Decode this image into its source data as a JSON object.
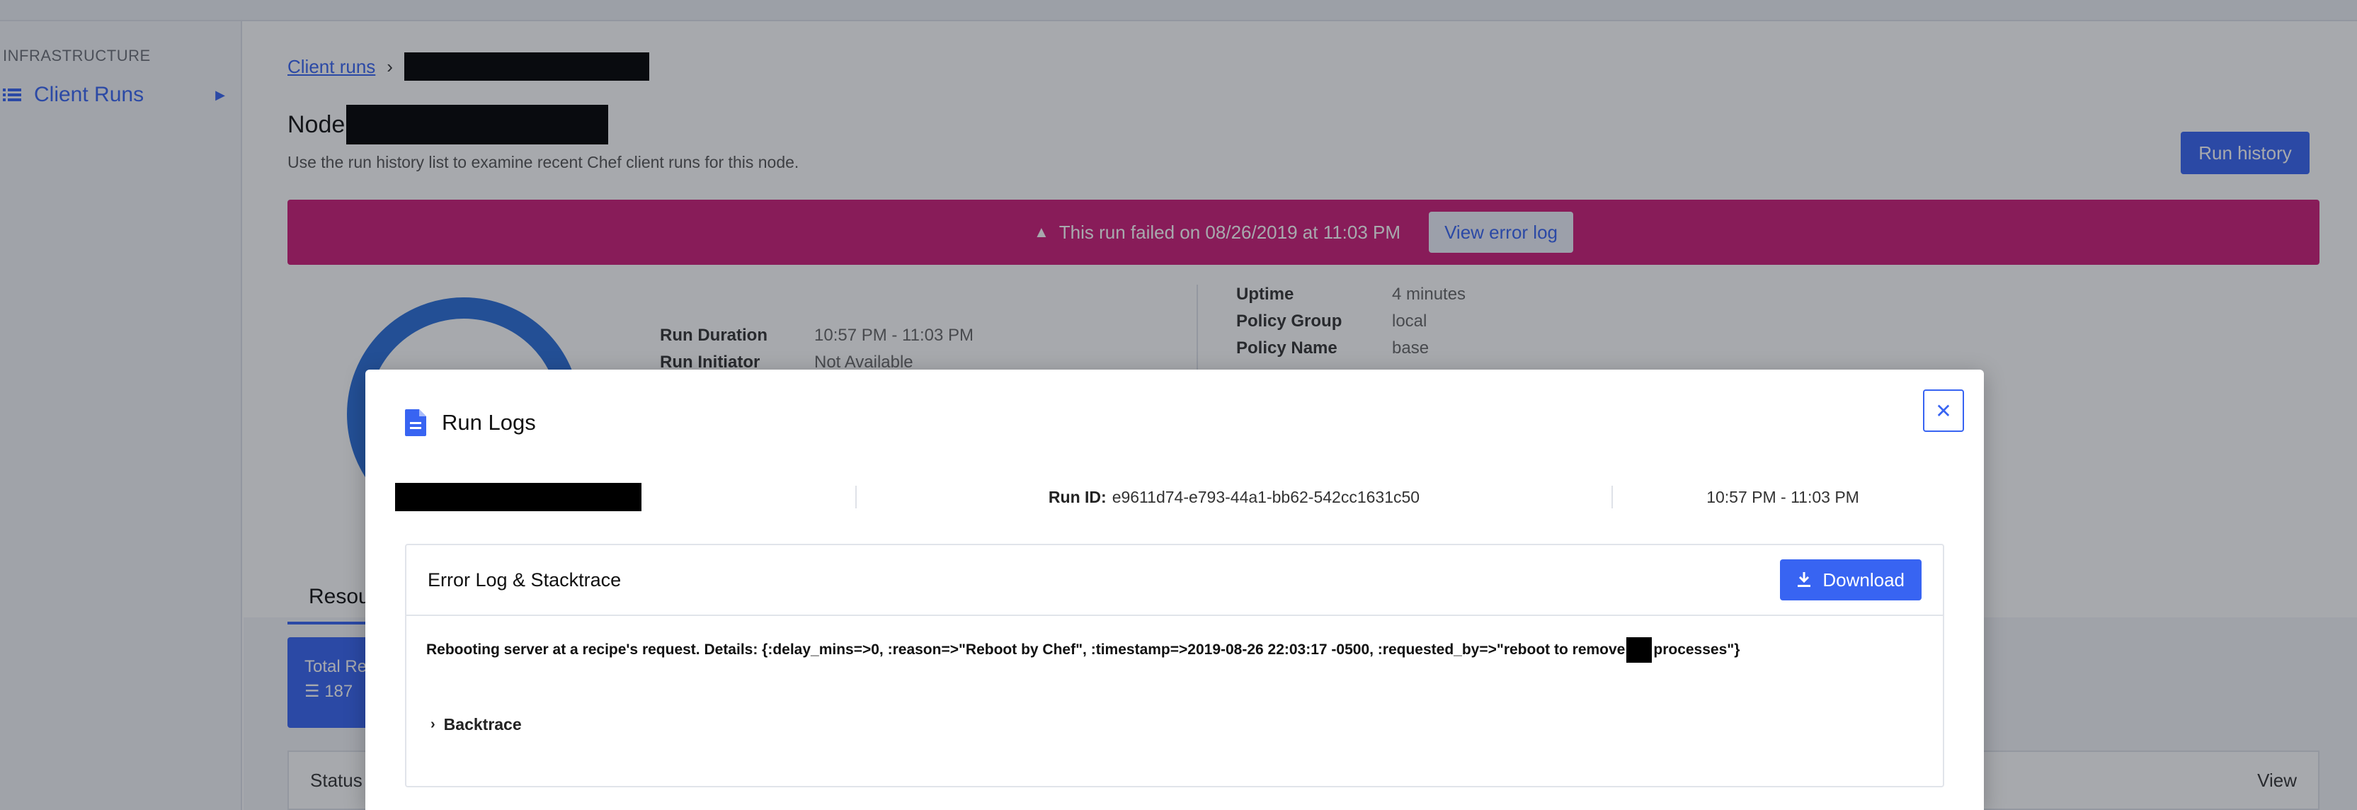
{
  "sidebar": {
    "section": "INFRASTRUCTURE",
    "items": [
      {
        "label": "Client Runs"
      }
    ]
  },
  "breadcrumb": {
    "root": "Client runs"
  },
  "node": {
    "title_prefix": "Node",
    "subtitle": "Use the run history list to examine recent Chef client runs for this node.",
    "run_history_label": "Run history"
  },
  "banner": {
    "message": "This run failed on 08/26/2019 at 11:03 PM",
    "view_error_log_label": "View error log",
    "color": "#cd1c78"
  },
  "details": {
    "left": [
      {
        "key": "Run Duration",
        "value": "10:57 PM - 11:03 PM"
      },
      {
        "key": "Run Initiator",
        "value": "Not Available"
      }
    ],
    "right": [
      {
        "key": "Uptime",
        "value": "4 minutes"
      },
      {
        "key": "Policy Group",
        "value": "local"
      },
      {
        "key": "Policy Name",
        "value": "base"
      }
    ]
  },
  "tabs": {
    "active": "Resou"
  },
  "total_card": {
    "label": "Total Re",
    "count": "187"
  },
  "status_row": {
    "left": "Status",
    "right": "View"
  },
  "modal": {
    "title": "Run Logs",
    "run_id_label": "Run ID:",
    "run_id": "e9611d74-e793-44a1-bb62-542cc1631c50",
    "time_range": "10:57 PM - 11:03 PM",
    "close_icon": "close-icon",
    "error_panel": {
      "title": "Error Log & Stacktrace",
      "download_label": "Download",
      "message_part1": "Rebooting server at a recipe's request. Details: {:delay_mins=>0, :reason=>\"Reboot by Chef\", :timestamp=>2019-08-26 22:03:17 -0500, :requested_by=>\"reboot to remove",
      "message_part2": "processes\"}",
      "backtrace_label": "Backtrace"
    }
  },
  "colors": {
    "accent": "#3864f2",
    "donut": "#2a6fd8"
  }
}
